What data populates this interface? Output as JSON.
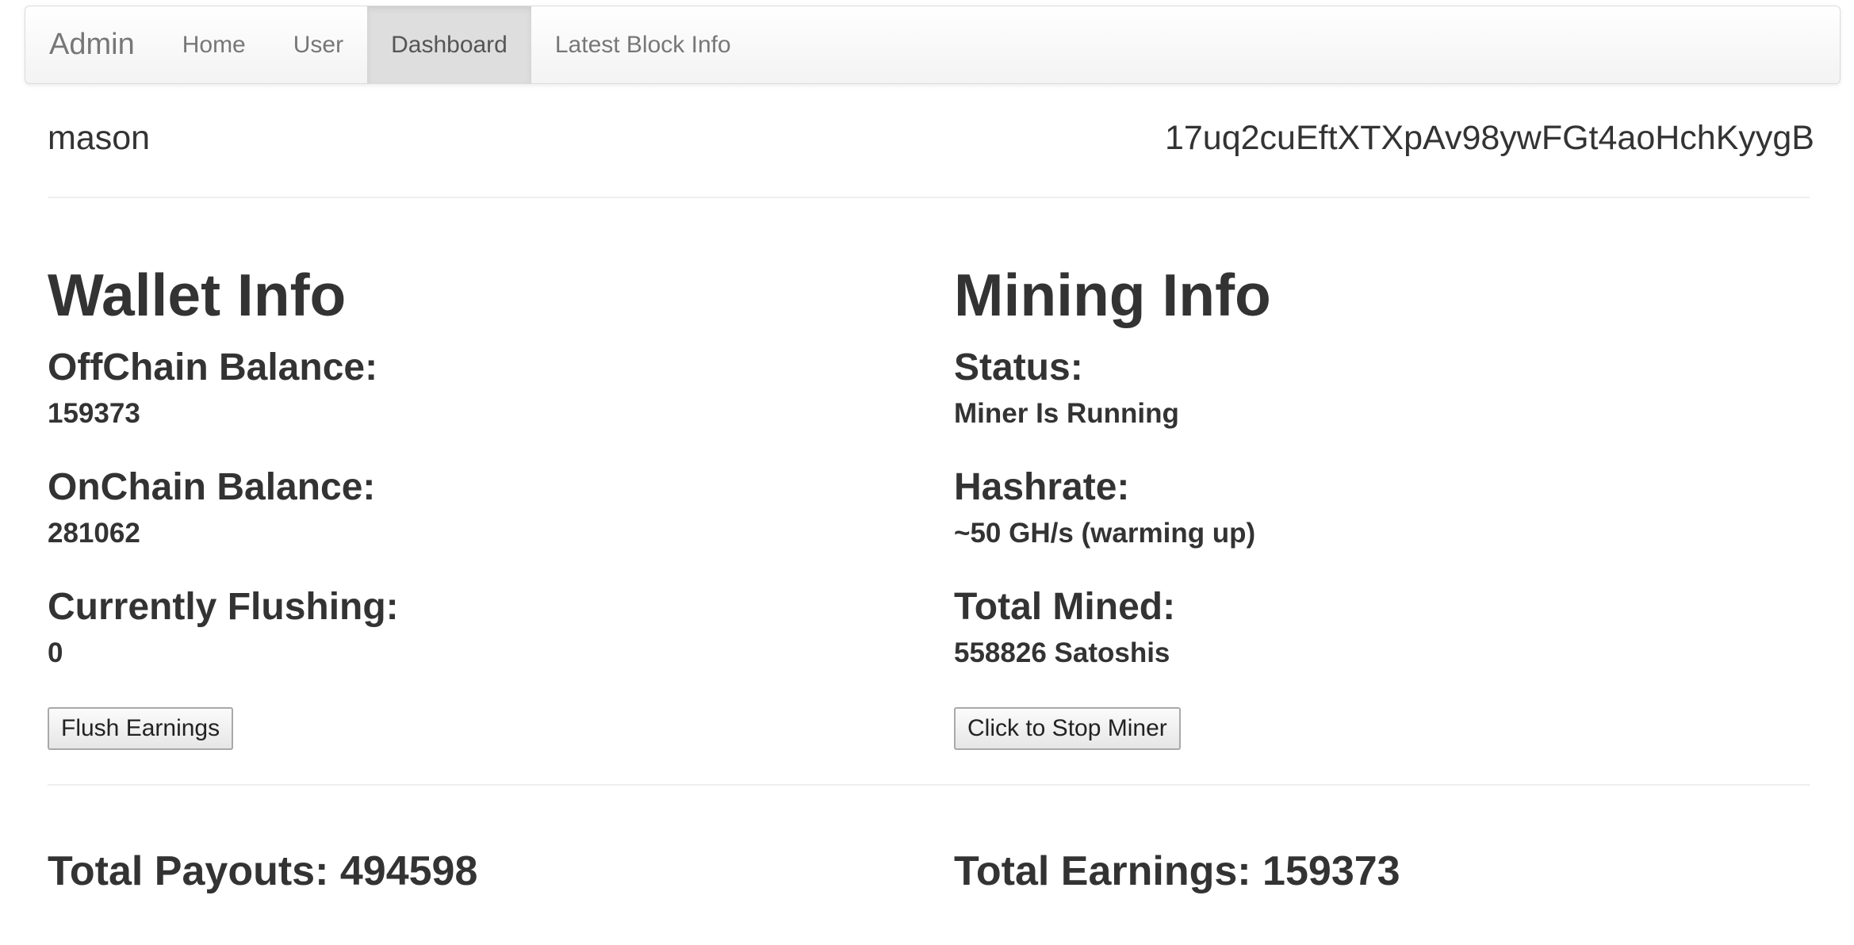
{
  "navbar": {
    "brand": "Admin",
    "items": [
      {
        "label": "Home"
      },
      {
        "label": "User"
      },
      {
        "label": "Dashboard",
        "active": true
      },
      {
        "label": "Latest Block Info"
      }
    ]
  },
  "user": {
    "name": "mason",
    "address": "17uq2cuEftXTXpAv98ywFGt4aoHchKyygB"
  },
  "wallet": {
    "title": "Wallet Info",
    "offchain_label": "OffChain Balance:",
    "offchain_value": "159373",
    "onchain_label": "OnChain Balance:",
    "onchain_value": "281062",
    "flushing_label": "Currently Flushing:",
    "flushing_value": "0",
    "flush_button": "Flush Earnings"
  },
  "mining": {
    "title": "Mining Info",
    "status_label": "Status:",
    "status_value": "Miner Is Running",
    "hashrate_label": "Hashrate:",
    "hashrate_value": "~50 GH/s (warming up)",
    "mined_label": "Total Mined:",
    "mined_value": "558826 Satoshis",
    "stop_button": "Click to Stop Miner"
  },
  "totals": {
    "payouts": "Total Payouts: 494598",
    "earnings": "Total Earnings: 159373"
  }
}
